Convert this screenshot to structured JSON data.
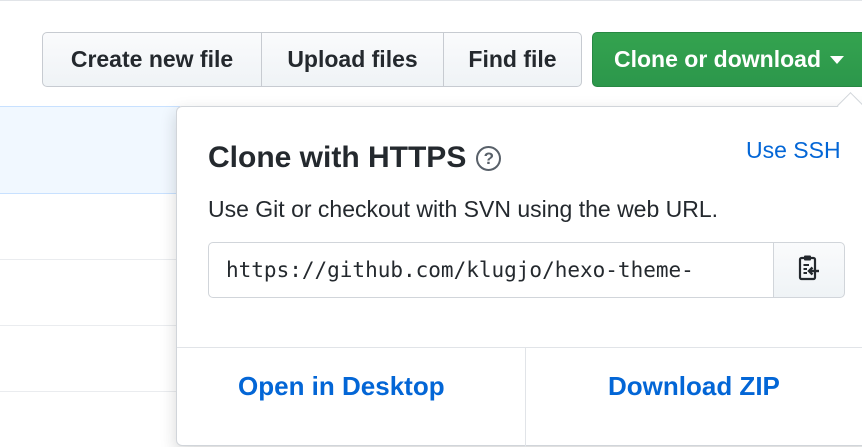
{
  "toolbar": {
    "create_label": "Create new file",
    "upload_label": "Upload files",
    "find_label": "Find file",
    "clone_label": "Clone or download"
  },
  "popover": {
    "title": "Clone with HTTPS",
    "help_glyph": "?",
    "use_ssh": "Use SSH",
    "description": "Use Git or checkout with SVN using the web URL.",
    "url_value": "https://github.com/klugjo/hexo-theme-",
    "copy_icon": "clipboard-icon",
    "open_desktop": "Open in Desktop",
    "download_zip": "Download ZIP"
  },
  "colors": {
    "accent_green": "#2c974b",
    "link_blue": "#0366d6",
    "text": "#24292e"
  }
}
